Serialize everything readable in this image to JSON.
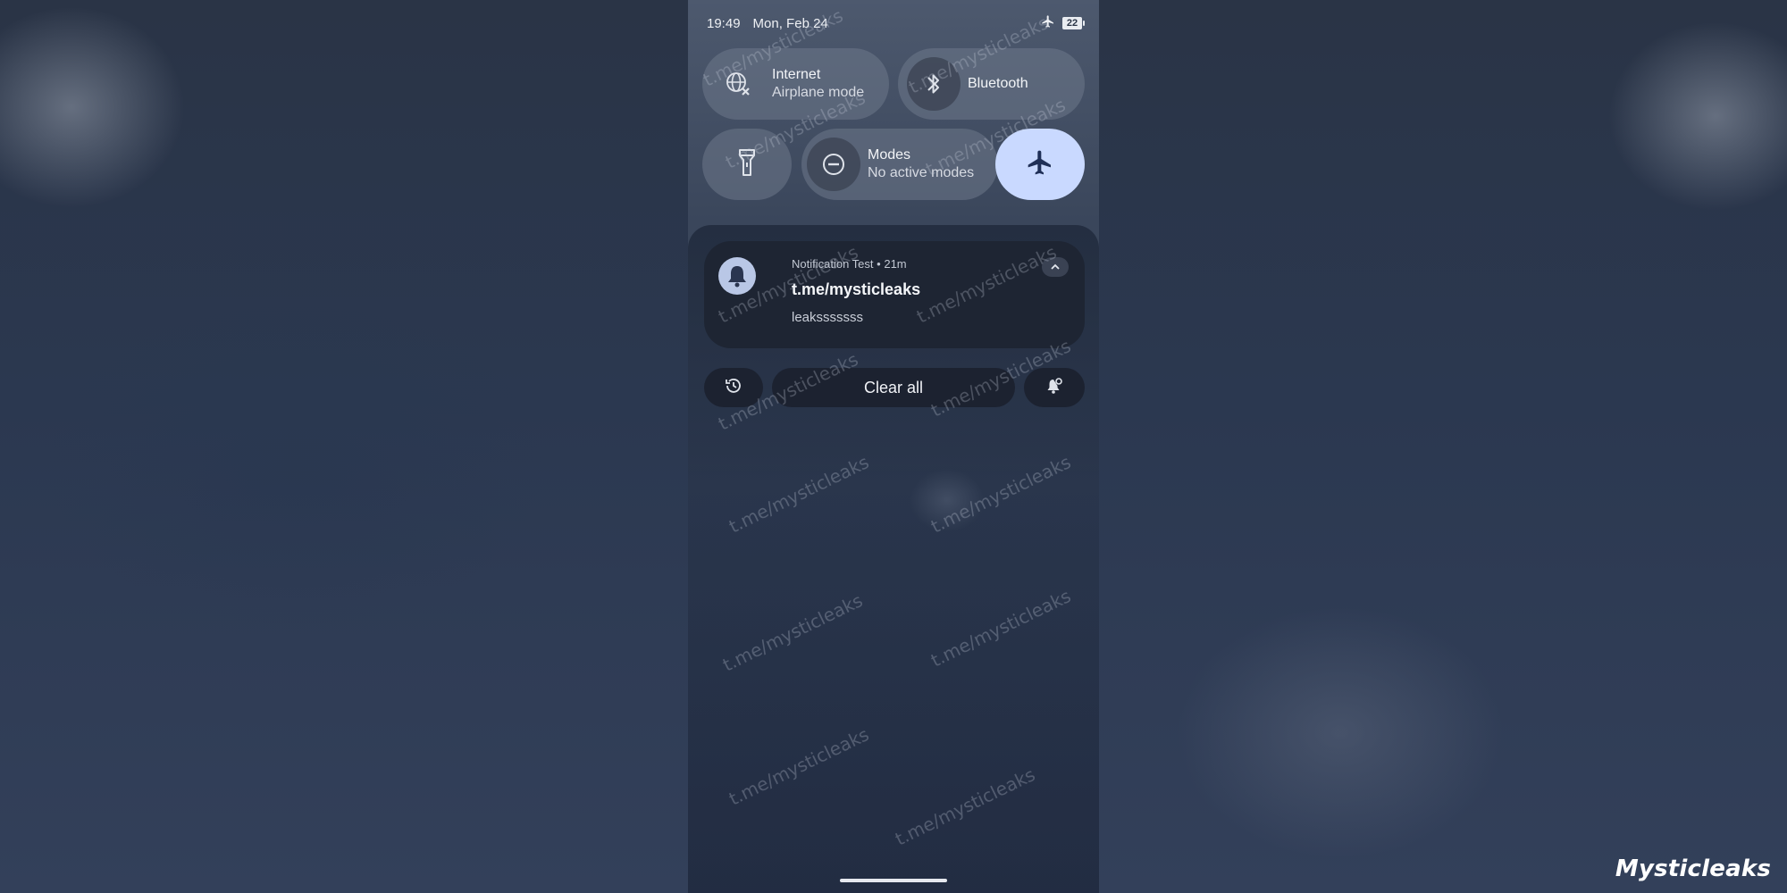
{
  "status_bar": {
    "time": "19:49",
    "date": "Mon, Feb 24",
    "battery": "22"
  },
  "quick_settings": {
    "internet": {
      "title": "Internet",
      "subtitle": "Airplane mode"
    },
    "bluetooth": {
      "title": "Bluetooth"
    },
    "flashlight": {
      "icon": "flashlight-icon"
    },
    "modes": {
      "title": "Modes",
      "subtitle": "No active modes"
    },
    "airplane": {
      "icon": "airplane-icon",
      "active": true,
      "active_color": "#c9d9ff"
    }
  },
  "notification": {
    "app": "Notification Test",
    "separator": "•",
    "time": "21m",
    "title": "t.me/mysticleaks",
    "body": "leaksssssss"
  },
  "actions": {
    "clear_all": "Clear all"
  },
  "watermark": {
    "text": "t.me/mysticleaks",
    "brand": "Mysticleaks"
  }
}
